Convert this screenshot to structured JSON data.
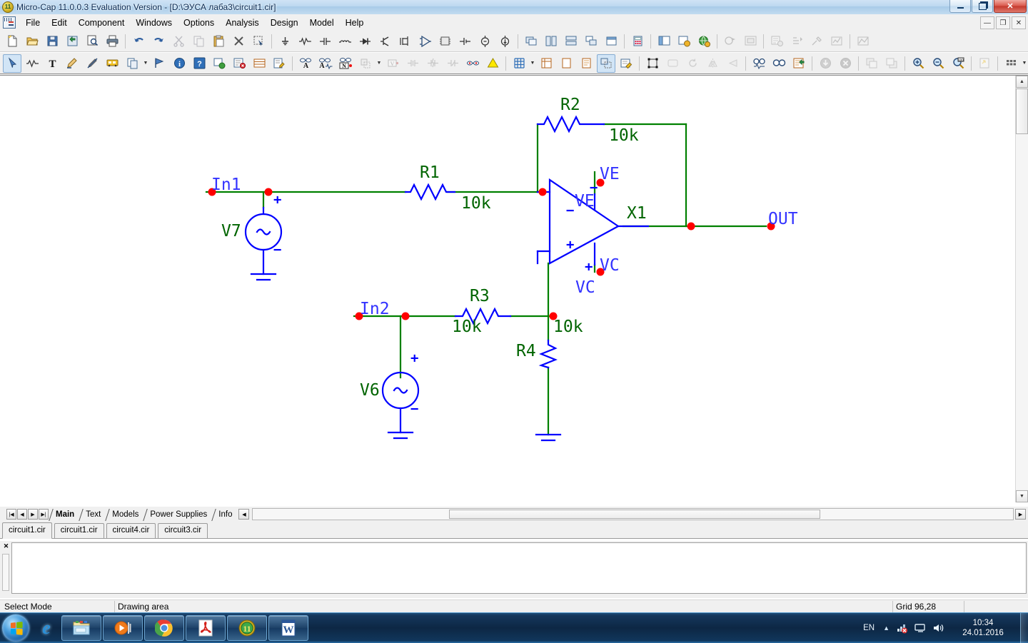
{
  "window": {
    "title": "Micro-Cap 11.0.0.3 Evaluation Version - [D:\\ЭУСА лаба3\\circuit1.cir]",
    "app_badge": "11",
    "minimize_label": "",
    "restore_label": "",
    "close_label": "✕"
  },
  "mdi_controls": {
    "minimize": "—",
    "restore": "❐",
    "close": "✕"
  },
  "menu": {
    "items": [
      {
        "label": "File",
        "name": "menu-file"
      },
      {
        "label": "Edit",
        "name": "menu-edit"
      },
      {
        "label": "Component",
        "name": "menu-component"
      },
      {
        "label": "Windows",
        "name": "menu-windows"
      },
      {
        "label": "Options",
        "name": "menu-options"
      },
      {
        "label": "Analysis",
        "name": "menu-analysis"
      },
      {
        "label": "Design",
        "name": "menu-design"
      },
      {
        "label": "Model",
        "name": "menu-model"
      },
      {
        "label": "Help",
        "name": "menu-help"
      }
    ]
  },
  "toolbar_row1": {
    "groups": [
      [
        "new-file-icon",
        "open-folder-icon",
        "save-icon",
        "save-all-icon",
        "print-preview-icon",
        "print-icon"
      ],
      [
        "undo-icon",
        "redo-icon",
        "cut-icon",
        "copy-icon",
        "paste-icon",
        "delete-icon",
        "select-region-icon"
      ],
      [
        "ground-icon",
        "resistor-icon",
        "capacitor-icon",
        "inductor-icon",
        "diode-icon",
        "transistor-icon",
        "nmos-icon",
        "opamp-icon",
        "ic-icon",
        "battery-icon",
        "voltage-source-icon",
        "current-source-icon"
      ],
      [
        "stack-windows-icon",
        "tile-vertical-icon",
        "tile-horizontal-icon",
        "cascade-icon",
        "maximize-window-icon",
        "calculator-icon"
      ],
      [
        "component-panel-icon",
        "component-editor-icon",
        "web-icon"
      ],
      [
        "animate-icon",
        "window-frame-icon"
      ],
      [
        "model-setup-icon",
        "stepping-icon",
        "optimize-icon",
        "probe-icon"
      ],
      [
        "waveform-buffer-icon"
      ]
    ]
  },
  "toolbar_row2": {
    "groups": [
      [
        "select-arrow-icon",
        "wire-icon",
        "text-icon",
        "graphic-pen-icon",
        "line-pen-icon",
        "bus-icon",
        "copy-object-icon"
      ],
      [
        "flag-icon",
        "info-icon",
        "help-circle-icon",
        "web-link-icon",
        "check-list-icon",
        "grid-table-icon",
        "edit-note-icon"
      ],
      [
        "attribute-text-icon",
        "attribute-value-icon",
        "node-number-icon",
        "rubberband-icon"
      ],
      [
        "dc-voltage-icon",
        "current-meter-icon",
        "power-icon",
        "condition-icon",
        "node-pair-icon",
        "warning-icon"
      ],
      [
        "grid-toggle-icon",
        "grid-dropdown-icon"
      ],
      [
        "title-block-icon",
        "page-icon",
        "page-border-icon",
        "scale-icon",
        "edit-page-icon"
      ],
      [
        "group-box-icon",
        "rounded-box-icon",
        "rotate-icon",
        "mirror-h-icon",
        "mirror-v-icon"
      ],
      [
        "find-icon",
        "find-component-icon",
        "refresh-page-icon"
      ],
      [
        "down-arrow-circle-icon",
        "x-circle-icon"
      ],
      [
        "bring-front-icon",
        "send-back-icon"
      ],
      [
        "zoom-in-icon",
        "zoom-out-icon",
        "zoom-100-icon"
      ],
      [
        "fit-page-icon"
      ],
      [
        "panel-grid-icon",
        "panel-dropdown-icon",
        "font-icon"
      ]
    ]
  },
  "schematic": {
    "nodes": [
      {
        "name": "In1",
        "color": "#0000ff"
      },
      {
        "name": "In2",
        "color": "#0000ff"
      },
      {
        "name": "OUT",
        "color": "#0000ff"
      },
      {
        "name": "VE",
        "color": "#0000ff"
      },
      {
        "name": "VC",
        "color": "#0000ff"
      }
    ],
    "components": [
      {
        "ref": "R1",
        "value": "10k",
        "type": "resistor"
      },
      {
        "ref": "R2",
        "value": "10k",
        "type": "resistor"
      },
      {
        "ref": "R3",
        "value": "10k",
        "type": "resistor"
      },
      {
        "ref": "R4",
        "value": "10k",
        "type": "resistor"
      },
      {
        "ref": "V7",
        "value": "",
        "type": "ac-source"
      },
      {
        "ref": "V6",
        "value": "",
        "type": "ac-source"
      },
      {
        "ref": "X1",
        "value": "",
        "type": "opamp"
      }
    ],
    "labels": {
      "in1": "In1",
      "in2": "In2",
      "out": "OUT",
      "ve_pin": "VE",
      "ve_node": "VE",
      "vc_pin": "VC",
      "vc_node": "VC",
      "r1": "R1",
      "r1v": "10k",
      "r2": "R2",
      "r2v": "10k",
      "r3": "R3",
      "r3v": "10k",
      "r4": "R4",
      "r4v": "10k",
      "v7": "V7",
      "v6": "V6",
      "x1": "X1",
      "plus": "+",
      "minus": "−",
      "opamp_minus": "−",
      "opamp_plus": "+"
    },
    "colors": {
      "wire_green": "#008000",
      "symbol_blue": "#0000ff",
      "ref_green": "#006400",
      "node_label_blue": "#3333ff",
      "pin_dot_red": "#ff0000",
      "background": "#ffffff"
    }
  },
  "sheet_tabs": {
    "nav": [
      "|◀",
      "◀",
      "▶",
      "▶|"
    ],
    "items": [
      {
        "label": "Main",
        "active": true
      },
      {
        "label": "Text",
        "active": false
      },
      {
        "label": "Models",
        "active": false
      },
      {
        "label": "Power Supplies",
        "active": false
      },
      {
        "label": "Info",
        "active": false
      }
    ]
  },
  "file_tabs": {
    "items": [
      {
        "label": "circuit1.cir",
        "active": true
      },
      {
        "label": "circuit1.cir",
        "active": false
      },
      {
        "label": "circuit4.cir",
        "active": false
      },
      {
        "label": "circuit3.cir",
        "active": false
      }
    ]
  },
  "message_panel": {
    "close_label": "✕",
    "content": ""
  },
  "statusbar": {
    "mode": "Select Mode",
    "area": "Drawing area",
    "grid": "Grid 96,28",
    "extra": ""
  },
  "taskbar": {
    "start_label": "",
    "buttons": [
      {
        "name": "taskbar-internet-explorer",
        "label": ""
      },
      {
        "name": "taskbar-explorer",
        "label": ""
      },
      {
        "name": "taskbar-media-player",
        "label": ""
      },
      {
        "name": "taskbar-chrome",
        "label": ""
      },
      {
        "name": "taskbar-acrobat",
        "label": ""
      },
      {
        "name": "taskbar-microcap",
        "label": ""
      },
      {
        "name": "taskbar-word",
        "label": "W"
      }
    ],
    "tray": {
      "language": "EN",
      "chevron": "▲",
      "time": "10:34",
      "date": "24.01.2016"
    }
  }
}
